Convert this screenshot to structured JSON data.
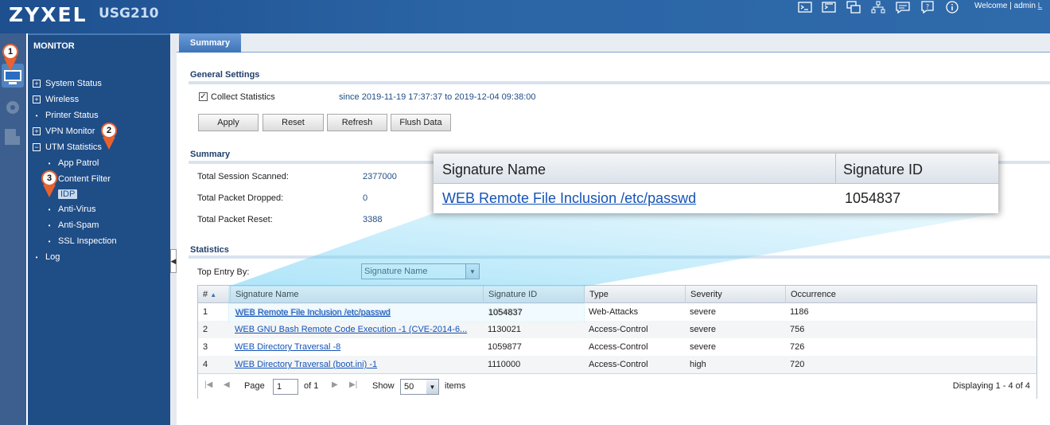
{
  "header": {
    "logo": "ZYXEL",
    "model": "USG210",
    "welcome": "Welcome | admin",
    "logout": "L",
    "icons": [
      "console-icon",
      "cli-icon",
      "site-map-icon",
      "object-reference-icon",
      "console-message-icon",
      "help-icon",
      "about-icon"
    ]
  },
  "nav": {
    "title": "MONITOR",
    "items": [
      {
        "label": "System Status",
        "marker": "⊞"
      },
      {
        "label": "Wireless",
        "marker": "⊞"
      },
      {
        "label": "Printer Status",
        "marker": "•"
      },
      {
        "label": "VPN Monitor",
        "marker": "⊞"
      },
      {
        "label": "UTM Statistics",
        "marker": "⊟"
      },
      {
        "label": "App Patrol",
        "marker": "•"
      },
      {
        "label": "Content Filter",
        "marker": "•"
      },
      {
        "label": "IDP",
        "marker": ""
      },
      {
        "label": "Anti-Virus",
        "marker": "•"
      },
      {
        "label": "Anti-Spam",
        "marker": "•"
      },
      {
        "label": "SSL Inspection",
        "marker": "•"
      },
      {
        "label": "Log",
        "marker": "•"
      }
    ],
    "badges": [
      "1",
      "2",
      "3"
    ]
  },
  "tabs": [
    "Summary"
  ],
  "general": {
    "title": "General Settings",
    "collect_label": "Collect Statistics",
    "collect_checked": true,
    "since": "since 2019-11-19 17:37:37 to 2019-12-04 09:38:00",
    "buttons": [
      "Apply",
      "Reset",
      "Refresh",
      "Flush Data"
    ]
  },
  "summary": {
    "title": "Summary",
    "rows": [
      {
        "label": "Total Session Scanned:",
        "value": "2377000"
      },
      {
        "label": "Total Packet Dropped:",
        "value": "0"
      },
      {
        "label": "Total Packet Reset:",
        "value": "3388"
      }
    ]
  },
  "statistics": {
    "title": "Statistics",
    "top_entry_label": "Top Entry By:",
    "top_entry_value": "Signature Name",
    "columns": [
      "#",
      "Signature Name",
      "Signature ID",
      "Type",
      "Severity",
      "Occurrence"
    ],
    "sort_indicator": "▲",
    "rows": [
      [
        "1",
        "WEB Remote File Inclusion /etc/passwd",
        "1054837",
        "Web-Attacks",
        "severe",
        "1186"
      ],
      [
        "2",
        "WEB GNU Bash Remote Code Execution -1 (CVE-2014-6...",
        "1130021",
        "Access-Control",
        "severe",
        "756"
      ],
      [
        "3",
        "WEB Directory Traversal -8",
        "1059877",
        "Access-Control",
        "severe",
        "726"
      ],
      [
        "4",
        "WEB Directory Traversal (boot.ini) -1",
        "1110000",
        "Access-Control",
        "high",
        "720"
      ]
    ],
    "pager": {
      "page_label": "Page",
      "page_value": "1",
      "of_label": "of 1",
      "show_label": "Show",
      "show_value": "50",
      "items_label": "items",
      "display": "Displaying 1 - 4 of 4"
    }
  },
  "zoom": {
    "col1": "Signature Name",
    "col2": "Signature ID",
    "name": "WEB Remote File Inclusion /etc/passwd",
    "id": "1054837"
  },
  "colors": {
    "accent": "#1f4d86",
    "badge": "#e8622f",
    "link": "#1553b6",
    "highlight": "#6fd0f5"
  }
}
